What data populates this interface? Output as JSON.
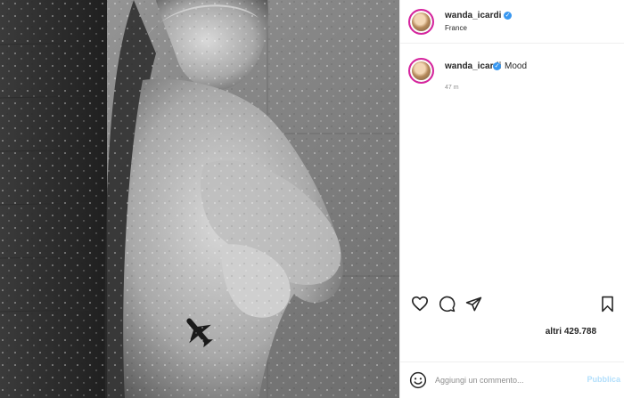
{
  "post": {
    "author": "wanda_icardi",
    "location": "France",
    "caption": "Mood",
    "time_ago": "47 m",
    "likes_text": "altri 429.788"
  },
  "comment": {
    "placeholder": "Aggiungi un commento...",
    "publish_label": "Pubblica"
  },
  "icons": {
    "verified": "verified-badge-icon",
    "like": "heart-icon",
    "comment": "comment-bubble-icon",
    "share": "paper-plane-icon",
    "save": "bookmark-icon",
    "emoji": "smiley-icon"
  },
  "colors": {
    "verified": "#3897f0",
    "text": "#262626",
    "muted": "#8e8e8e",
    "publish_disabled": "#b2dffc",
    "border": "#efefef"
  }
}
